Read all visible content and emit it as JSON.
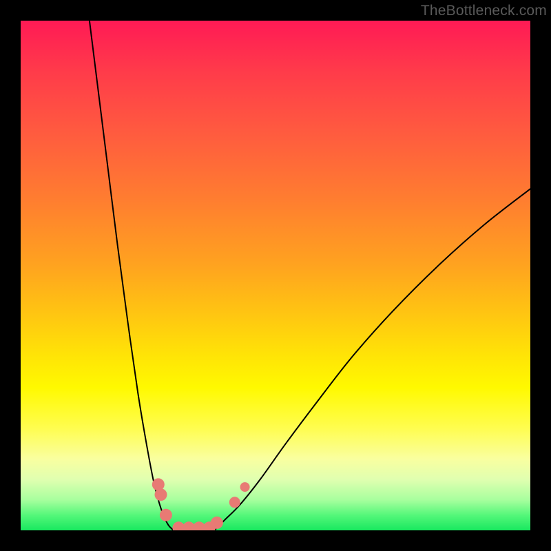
{
  "watermark": "TheBottleneck.com",
  "chart_data": {
    "type": "line",
    "title": "",
    "xlabel": "",
    "ylabel": "",
    "xlim": [
      0,
      100
    ],
    "ylim": [
      0,
      100
    ],
    "grid": false,
    "legend": false,
    "background_gradient": [
      "#ff1a55",
      "#ff7d30",
      "#ffe506",
      "#18e85f"
    ],
    "series": [
      {
        "name": "left-branch",
        "color": "#000000",
        "stroke_width": 2,
        "x": [
          13.5,
          15,
          17,
          19,
          21,
          23,
          24.5,
          26,
          27,
          28,
          29,
          30
        ],
        "y": [
          100,
          88,
          72,
          56,
          41,
          27,
          18,
          10,
          6,
          3,
          1,
          0
        ]
      },
      {
        "name": "right-branch",
        "color": "#000000",
        "stroke_width": 2,
        "x": [
          38,
          40,
          43,
          47,
          52,
          58,
          65,
          73,
          82,
          91,
          100
        ],
        "y": [
          0,
          2,
          5,
          10,
          17,
          25,
          34,
          43,
          52,
          60,
          67
        ]
      },
      {
        "name": "valley-floor",
        "color": "#000000",
        "stroke_width": 2,
        "x": [
          30,
          32,
          34,
          36,
          38
        ],
        "y": [
          0,
          0,
          0,
          0,
          0
        ]
      }
    ],
    "markers": [
      {
        "name": "dot-left-1",
        "x": 27.0,
        "y": 9.0,
        "color": "#e87a74",
        "r": 9
      },
      {
        "name": "dot-left-2",
        "x": 27.5,
        "y": 7.0,
        "color": "#e87a74",
        "r": 9
      },
      {
        "name": "dot-left-3",
        "x": 28.5,
        "y": 3.0,
        "color": "#e87a74",
        "r": 9
      },
      {
        "name": "dot-floor-1",
        "x": 31.0,
        "y": 0.5,
        "color": "#e87a74",
        "r": 9
      },
      {
        "name": "dot-floor-2",
        "x": 33.0,
        "y": 0.5,
        "color": "#e87a74",
        "r": 9
      },
      {
        "name": "dot-floor-3",
        "x": 35.0,
        "y": 0.5,
        "color": "#e87a74",
        "r": 9
      },
      {
        "name": "dot-floor-4",
        "x": 37.0,
        "y": 0.5,
        "color": "#e87a74",
        "r": 9
      },
      {
        "name": "dot-right-1",
        "x": 38.5,
        "y": 1.5,
        "color": "#e87a74",
        "r": 9
      },
      {
        "name": "dot-right-2",
        "x": 42.0,
        "y": 5.5,
        "color": "#e87a74",
        "r": 8
      },
      {
        "name": "dot-right-3",
        "x": 44.0,
        "y": 8.5,
        "color": "#e87a74",
        "r": 7
      }
    ]
  }
}
